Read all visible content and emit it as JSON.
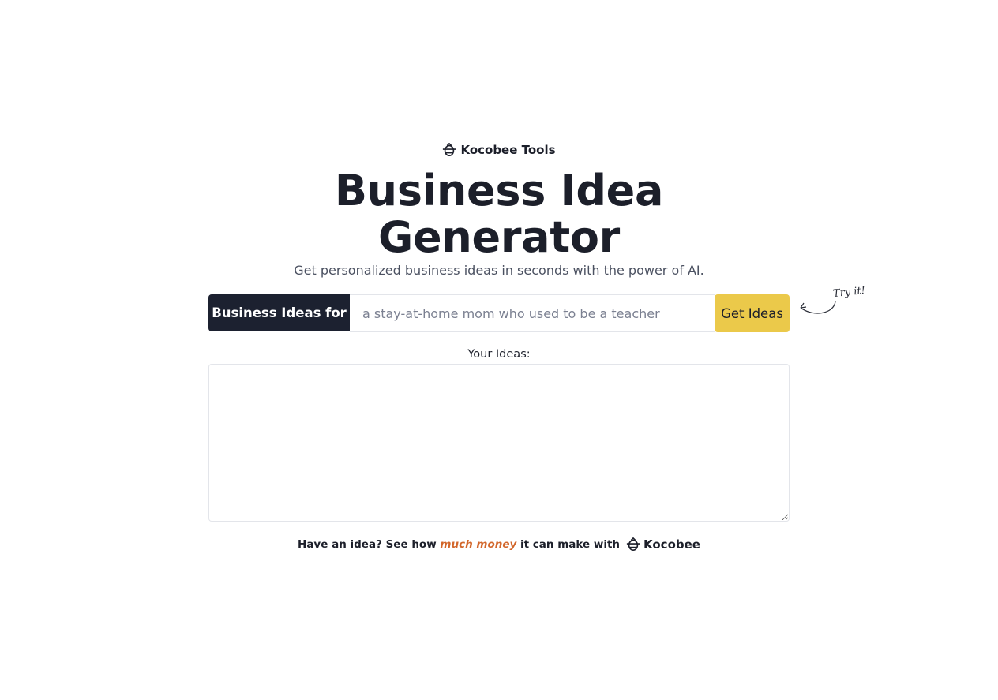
{
  "brand": {
    "icon": "kocobee-logo-icon",
    "name": "Kocobee Tools"
  },
  "hero": {
    "title_line1": "Business Idea",
    "title_line2": "Generator",
    "subtitle": "Get personalized business ideas in seconds with the power of AI."
  },
  "form": {
    "prefix_label": "Business Ideas for",
    "input_value": "",
    "input_placeholder": "a stay-at-home mom who used to be a teacher",
    "submit_label": "Get Ideas",
    "hint": "Try it!"
  },
  "output": {
    "label": "Your Ideas:",
    "value": ""
  },
  "footer": {
    "text_before": "Have an idea? See how ",
    "highlight": "much money",
    "text_after": " it can make with",
    "logo_icon": "kocobee-logo-icon",
    "logo_text": "Kocobee"
  },
  "colors": {
    "dark": "#1c2130",
    "accent_yellow": "#ebc94a",
    "highlight_orange": "#d2662a",
    "muted_text": "#4b5161"
  }
}
